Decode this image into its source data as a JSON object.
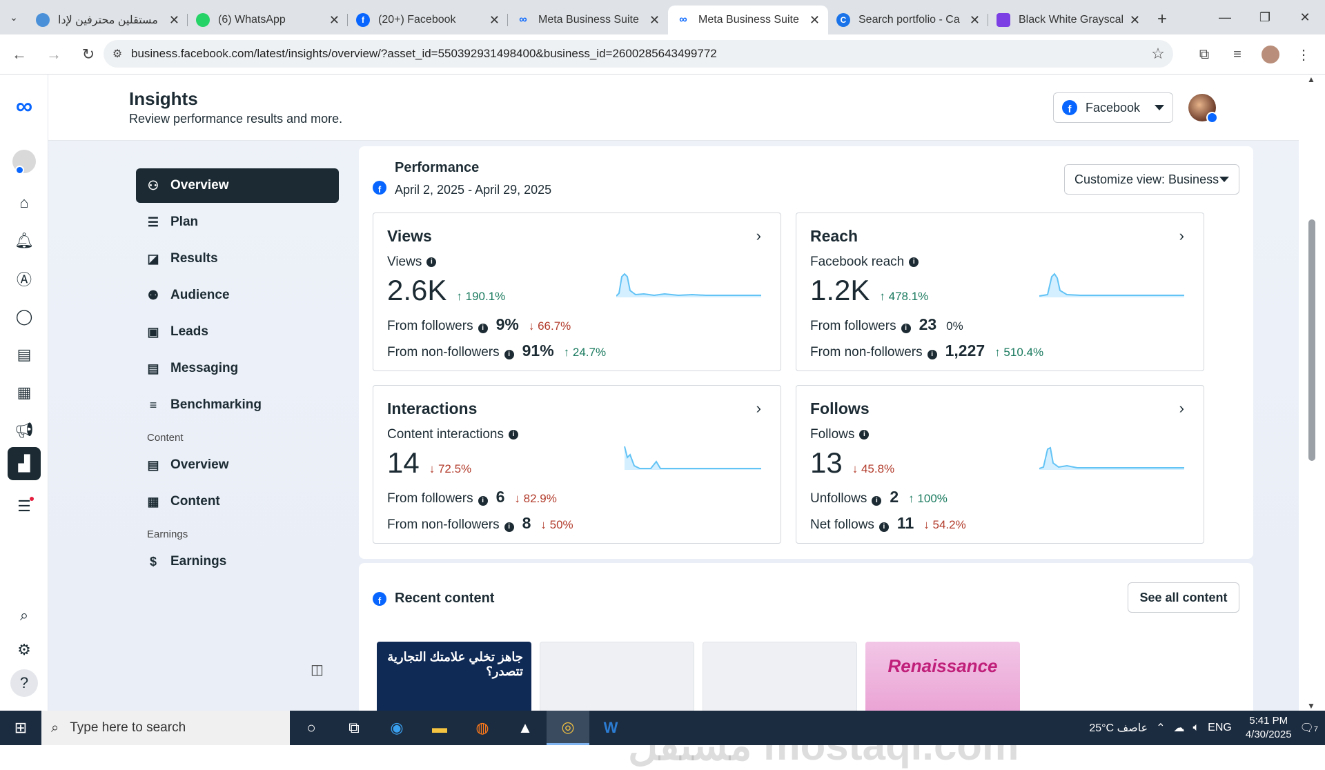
{
  "browser": {
    "tabs": [
      {
        "title": "مستقلين محترفين لإدا",
        "color": "#4a90d9"
      },
      {
        "title": "(6) WhatsApp",
        "color": "#25d366"
      },
      {
        "title": "(20+) Facebook",
        "color": "#0866ff"
      },
      {
        "title": "Meta Business Suite",
        "color": "#0866ff"
      },
      {
        "title": "Meta Business Suite",
        "color": "#0866ff",
        "active": true
      },
      {
        "title": "Search portfolio - Ca",
        "color": "#1a73e8"
      },
      {
        "title": "Black White Grayscal",
        "color": "#7b3fe4"
      }
    ],
    "url": "business.facebook.com/latest/insights/overview/?asset_id=550392931498400&business_id=2600285643499772"
  },
  "header": {
    "title": "Insights",
    "subtitle": "Review performance results and more.",
    "platform": "Facebook"
  },
  "sidebar": {
    "items": [
      {
        "label": "Overview",
        "icon": "network-icon"
      },
      {
        "label": "Plan",
        "icon": "list-icon"
      },
      {
        "label": "Results",
        "icon": "chart-icon"
      },
      {
        "label": "Audience",
        "icon": "people-icon"
      },
      {
        "label": "Leads",
        "icon": "contact-card-icon"
      },
      {
        "label": "Messaging",
        "icon": "message-icon"
      },
      {
        "label": "Benchmarking",
        "icon": "benchmark-icon"
      }
    ],
    "content_heading": "Content",
    "content_items": [
      {
        "label": "Overview"
      },
      {
        "label": "Content"
      }
    ],
    "earnings_heading": "Earnings",
    "earnings_items": [
      {
        "label": "Earnings"
      }
    ]
  },
  "performance": {
    "title": "Performance",
    "date_range": "April 2, 2025 - April 29, 2025",
    "customize": "Customize view: Business",
    "views": {
      "title": "Views",
      "label": "Views",
      "value": "2.6K",
      "change": "190.1%",
      "row1_label": "From followers",
      "row1_value": "9%",
      "row1_change": "66.7%",
      "row2_label": "From non-followers",
      "row2_value": "91%",
      "row2_change": "24.7%"
    },
    "reach": {
      "title": "Reach",
      "label": "Facebook reach",
      "value": "1.2K",
      "change": "478.1%",
      "row1_label": "From followers",
      "row1_value": "23",
      "row1_change": "0%",
      "row2_label": "From non-followers",
      "row2_value": "1,227",
      "row2_change": "510.4%"
    },
    "interactions": {
      "title": "Interactions",
      "label": "Content interactions",
      "value": "14",
      "change": "72.5%",
      "row1_label": "From followers",
      "row1_value": "6",
      "row1_change": "82.9%",
      "row2_label": "From non-followers",
      "row2_value": "8",
      "row2_change": "50%"
    },
    "follows": {
      "title": "Follows",
      "label": "Follows",
      "value": "13",
      "change": "45.8%",
      "row1_label": "Unfollows",
      "row1_value": "2",
      "row1_change": "100%",
      "row2_label": "Net follows",
      "row2_value": "11",
      "row2_change": "54.2%"
    }
  },
  "recent": {
    "title": "Recent content",
    "see_all": "See all content",
    "thumb1_text": "جاهز تخلي علامتك التجارية تتصدر؟",
    "thumb4_text": "Renaissance"
  },
  "watermark": "مستقل mostaql.com",
  "taskbar": {
    "search_placeholder": "Type here to search",
    "weather": "25°C عاصف",
    "lang": "ENG",
    "time": "5:41 PM",
    "date": "4/30/2025",
    "notifications": "7"
  }
}
